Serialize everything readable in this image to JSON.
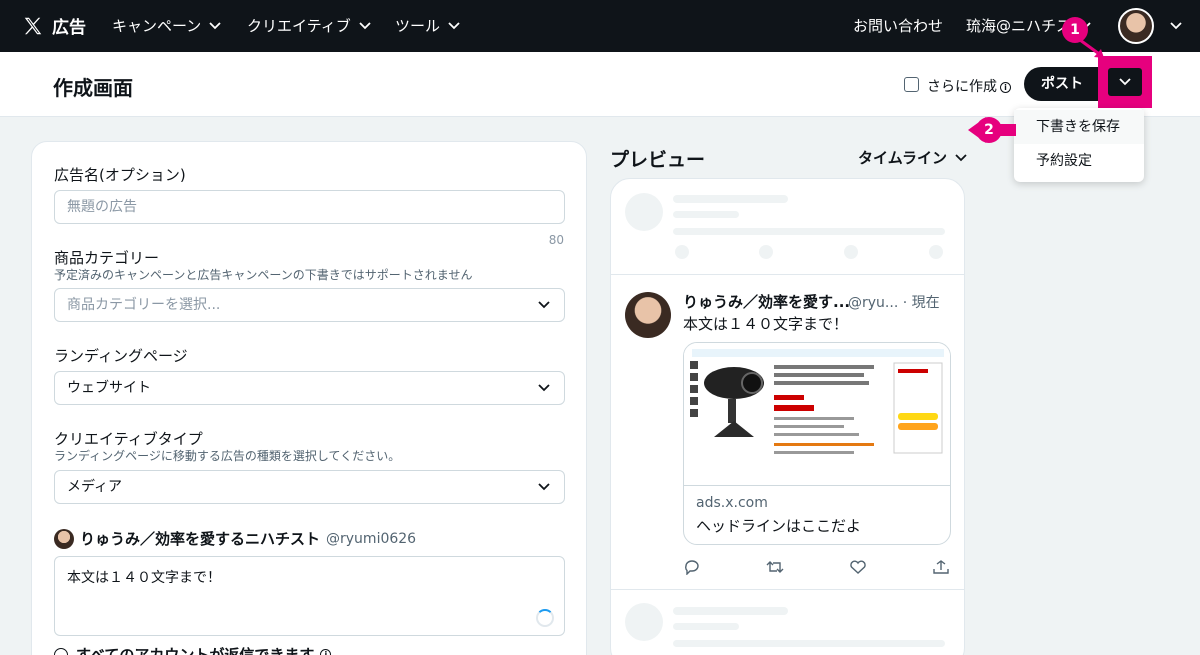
{
  "nav": {
    "brand": "広告",
    "menu": [
      {
        "label": "キャンペーン"
      },
      {
        "label": "クリエイティブ"
      },
      {
        "label": "ツール"
      }
    ],
    "contact": "お問い合わせ",
    "account": "琉海@ニハチス"
  },
  "header": {
    "title": "作成画面",
    "create_more_label": "さらに作成",
    "post_label": "ポスト"
  },
  "dropdown": {
    "items": [
      {
        "label": "下書きを保存"
      },
      {
        "label": "予約設定"
      }
    ]
  },
  "callouts": [
    "1",
    "2"
  ],
  "form": {
    "ad_name_label": "広告名(オプション)",
    "ad_name_placeholder": "無題の広告",
    "ad_name_counter": "80",
    "category_label": "商品カテゴリー",
    "category_note": "予定済みのキャンペーンと広告キャンペーンの下書きではサポートされません",
    "category_placeholder": "商品カテゴリーを選択...",
    "landing_label": "ランディングページ",
    "landing_value": "ウェブサイト",
    "creative_type_label": "クリエイティブタイプ",
    "creative_type_note": "ランディングページに移動する広告の種類を選択してください。",
    "creative_type_value": "メディア",
    "author_name": "りゅうみ／効率を愛するニハチスト",
    "author_handle": "@ryumi0626",
    "body_text": "本文は１４０文字まで！",
    "reply_setting": "すべてのアカウントが返信できます"
  },
  "preview": {
    "title": "プレビュー",
    "mode": "タイムライン",
    "tweet": {
      "name": "りゅうみ／効率を愛す...",
      "handle": "@ryu... · 現在",
      "text": "本文は１４０文字まで！",
      "card_domain": "ads.x.com",
      "card_headline": "ヘッドラインはここだよ"
    }
  },
  "colors": {
    "nav_bg": "#0f1419",
    "accent_magenta": "#e6007e",
    "link_blue": "#1d9bf0"
  }
}
